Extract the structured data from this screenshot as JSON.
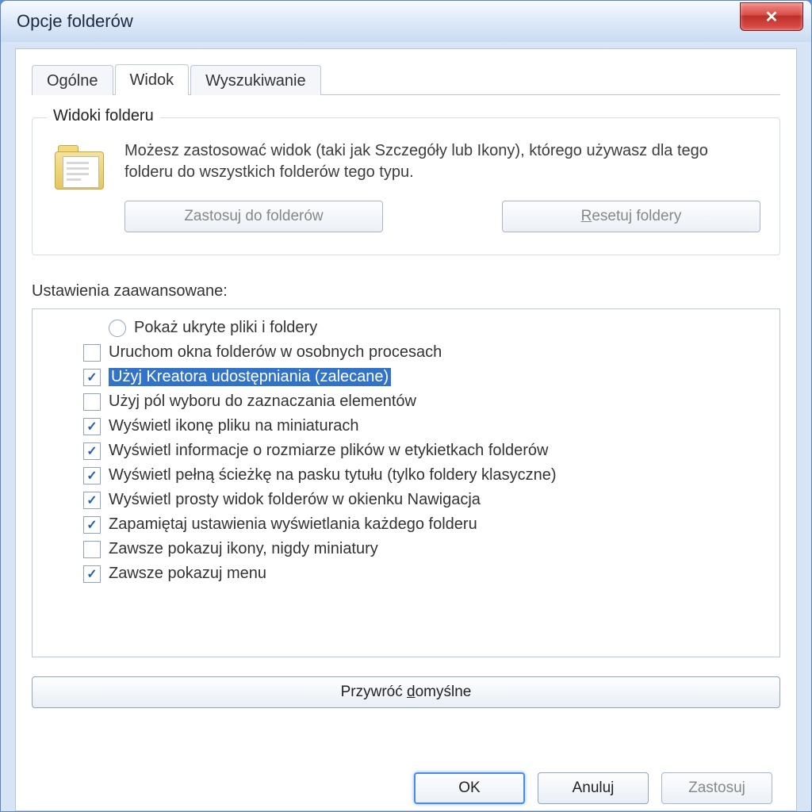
{
  "window": {
    "title": "Opcje folderów"
  },
  "tabs": {
    "general": "Ogólne",
    "view": "Widok",
    "search": "Wyszukiwanie",
    "active": "view"
  },
  "group": {
    "title": "Widoki folderu",
    "desc": "Możesz zastosować widok (taki jak Szczegóły lub Ikony), którego używasz dla tego folderu do wszystkich folderów tego typu.",
    "apply_btn": "Zastosuj do folderów",
    "reset_btn": "Resetuj foldery"
  },
  "advanced": {
    "label": "Ustawienia zaawansowane:",
    "items": [
      {
        "type": "radio",
        "checked": false,
        "selected": false,
        "label": "Pokaż ukryte pliki i foldery"
      },
      {
        "type": "checkbox",
        "checked": false,
        "selected": false,
        "label": "Uruchom okna folderów w osobnych procesach"
      },
      {
        "type": "checkbox",
        "checked": true,
        "selected": true,
        "label": "Użyj Kreatora udostępniania (zalecane)"
      },
      {
        "type": "checkbox",
        "checked": false,
        "selected": false,
        "label": "Użyj pól wyboru do zaznaczania elementów"
      },
      {
        "type": "checkbox",
        "checked": true,
        "selected": false,
        "label": "Wyświetl ikonę pliku na miniaturach"
      },
      {
        "type": "checkbox",
        "checked": true,
        "selected": false,
        "label": "Wyświetl informacje o rozmiarze plików w etykietkach folderów"
      },
      {
        "type": "checkbox",
        "checked": true,
        "selected": false,
        "label": "Wyświetl pełną ścieżkę na pasku tytułu (tylko foldery klasyczne)"
      },
      {
        "type": "checkbox",
        "checked": true,
        "selected": false,
        "label": "Wyświetl prosty widok folderów w okienku Nawigacja"
      },
      {
        "type": "checkbox",
        "checked": true,
        "selected": false,
        "label": "Zapamiętaj ustawienia wyświetlania każdego folderu"
      },
      {
        "type": "checkbox",
        "checked": false,
        "selected": false,
        "label": "Zawsze pokazuj ikony, nigdy miniatury"
      },
      {
        "type": "checkbox",
        "checked": true,
        "selected": false,
        "label": "Zawsze pokazuj menu"
      }
    ]
  },
  "buttons": {
    "restore_defaults": "Przywróć domyślne",
    "ok": "OK",
    "cancel": "Anuluj",
    "apply": "Zastosuj"
  }
}
